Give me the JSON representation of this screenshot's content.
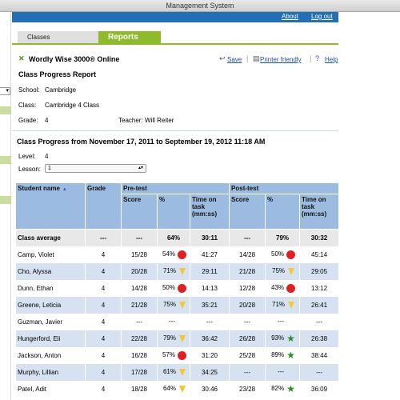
{
  "window": {
    "title": "Management System"
  },
  "toplinks": {
    "about": "About",
    "logout": "Log out"
  },
  "tabs": {
    "classes": "Classes",
    "reports": "Reports"
  },
  "header": {
    "product": "Wordly Wise 3000® Online",
    "save": "Save",
    "printer": "Printer friendly",
    "help": "Help",
    "report_title": "Class Progress Report"
  },
  "info": {
    "school_label": "School:",
    "school": "Cambridge",
    "class_label": "Class:",
    "class": "Cambridge 4 Class",
    "grade_label": "Grade:",
    "grade": "4",
    "teacher_label": "Teacher:",
    "teacher": "Will Reiter"
  },
  "progress": {
    "title": "Class Progress from November 17, 2011 to September 19, 2012 11:18 AM",
    "level_label": "Level:",
    "level": "4",
    "lesson_label": "Lesson:",
    "lesson": "1"
  },
  "table": {
    "headers": {
      "student": "Student name",
      "grade": "Grade",
      "pretest": "Pre-test",
      "posttest": "Post-test",
      "score": "Score",
      "pct": "%",
      "time": "Time on task (mm:ss)"
    },
    "average": {
      "name": "Class average",
      "grade": "---",
      "pre_score": "---",
      "pre_pct": "64%",
      "pre_time": "30:11",
      "post_score": "---",
      "post_pct": "79%",
      "post_time": "30:32"
    },
    "rows": [
      {
        "name": "Camp, Violet",
        "grade": "4",
        "pre_score": "15/28",
        "pre_pct": "54%",
        "pre_mark": "red",
        "pre_time": "41:27",
        "post_score": "14/28",
        "post_pct": "50%",
        "post_mark": "red",
        "post_time": "45:14"
      },
      {
        "name": "Cho, Alyssa",
        "grade": "4",
        "pre_score": "20/28",
        "pre_pct": "71%",
        "pre_mark": "yellow",
        "pre_time": "29:11",
        "post_score": "21/28",
        "post_pct": "75%",
        "post_mark": "yellow",
        "post_time": "29:05"
      },
      {
        "name": "Dunn, Ethan",
        "grade": "4",
        "pre_score": "14/28",
        "pre_pct": "50%",
        "pre_mark": "red",
        "pre_time": "14:13",
        "post_score": "12/28",
        "post_pct": "43%",
        "post_mark": "red",
        "post_time": "13:12"
      },
      {
        "name": "Greene, Leticia",
        "grade": "4",
        "pre_score": "21/28",
        "pre_pct": "75%",
        "pre_mark": "yellow",
        "pre_time": "35:21",
        "post_score": "20/28",
        "post_pct": "71%",
        "post_mark": "yellow",
        "post_time": "26:41"
      },
      {
        "name": "Guzman, Javier",
        "grade": "4",
        "pre_score": "---",
        "pre_pct": "---",
        "pre_mark": "none",
        "pre_time": "---",
        "post_score": "---",
        "post_pct": "---",
        "post_mark": "none",
        "post_time": "---"
      },
      {
        "name": "Hungerford, Eli",
        "grade": "4",
        "pre_score": "22/28",
        "pre_pct": "79%",
        "pre_mark": "yellow",
        "pre_time": "36:42",
        "post_score": "26/28",
        "post_pct": "93%",
        "post_mark": "star",
        "post_time": "26:38"
      },
      {
        "name": "Jackson, Anton",
        "grade": "4",
        "pre_score": "16/28",
        "pre_pct": "57%",
        "pre_mark": "red",
        "pre_time": "31:20",
        "post_score": "25/28",
        "post_pct": "89%",
        "post_mark": "star",
        "post_time": "38:44"
      },
      {
        "name": "Murphy, Lillian",
        "grade": "4",
        "pre_score": "17/28",
        "pre_pct": "61%",
        "pre_mark": "yellow",
        "pre_time": "34:25",
        "post_score": "---",
        "post_pct": "---",
        "post_mark": "none",
        "post_time": "---"
      },
      {
        "name": "Patel, Adit",
        "grade": "4",
        "pre_score": "18/28",
        "pre_pct": "64%",
        "pre_mark": "yellow",
        "pre_time": "30:46",
        "post_score": "23/28",
        "post_pct": "82%",
        "post_mark": "star",
        "post_time": "36:09"
      }
    ]
  }
}
